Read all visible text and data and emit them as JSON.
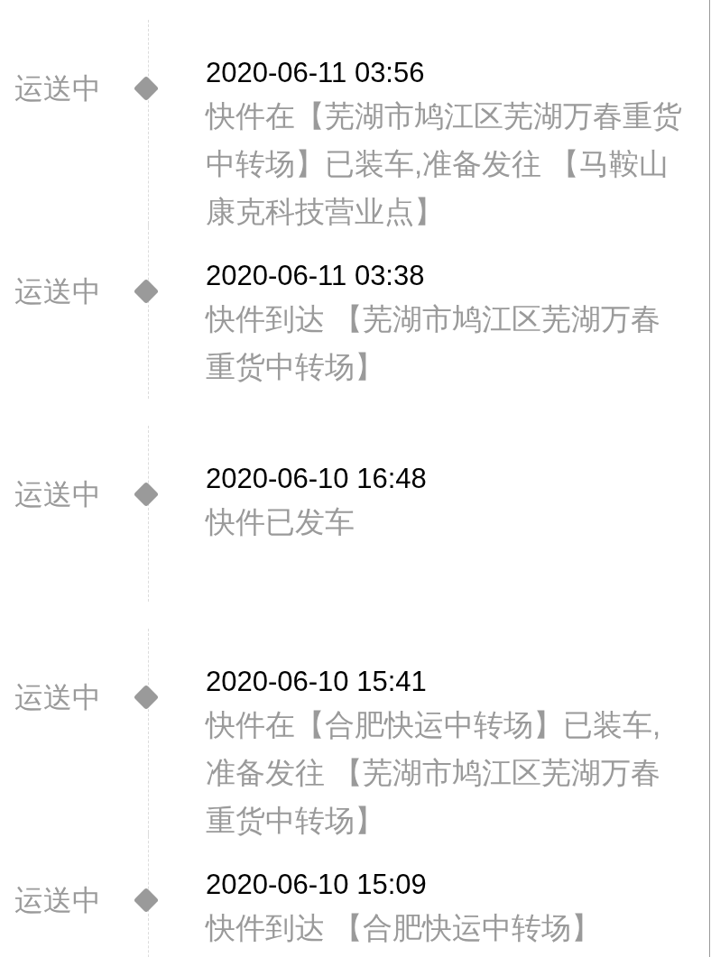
{
  "events": [
    {
      "status": "运送中",
      "time": "2020-06-11 03:56",
      "description": "快件在【芜湖市鸠江区芜湖万春重货中转场】已装车,准备发往 【马鞍山康克科技营业点】"
    },
    {
      "status": "运送中",
      "time": "2020-06-11 03:38",
      "description": "快件到达 【芜湖市鸠江区芜湖万春重货中转场】"
    },
    {
      "status": "运送中",
      "time": "2020-06-10 16:48",
      "description": "快件已发车"
    },
    {
      "status": "运送中",
      "time": "2020-06-10 15:41",
      "description": "快件在【合肥快运中转场】已装车,准备发往 【芜湖市鸠江区芜湖万春重货中转场】"
    },
    {
      "status": "运送中",
      "time": "2020-06-10 15:09",
      "description": "快件到达 【合肥快运中转场】"
    }
  ]
}
